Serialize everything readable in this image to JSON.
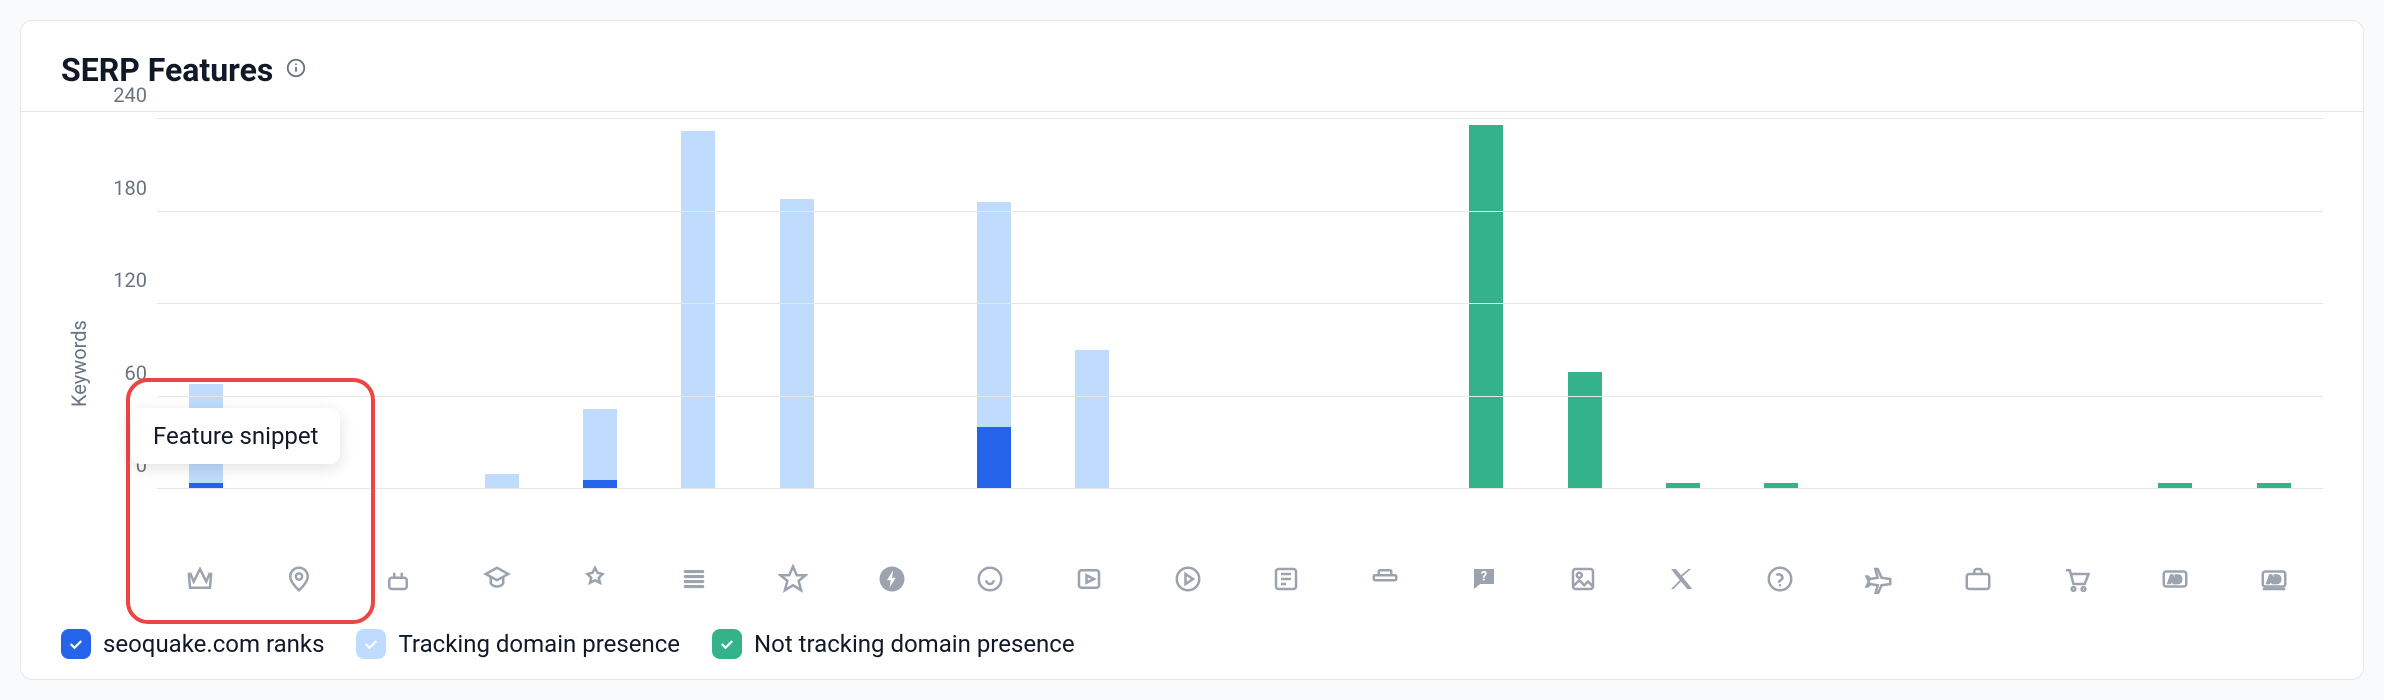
{
  "header": {
    "title": "SERP Features"
  },
  "axis": {
    "ylabel": "Keywords",
    "ymax": 240,
    "ticks": [
      0,
      60,
      120,
      180,
      240
    ]
  },
  "legend": {
    "ranks": "seoquake.com ranks",
    "tracking": "Tracking domain presence",
    "not_tracking": "Not tracking domain presence"
  },
  "tooltip": {
    "label": "Feature snippet"
  },
  "highlight_index": 0,
  "chart_data": {
    "type": "bar",
    "stacked": true,
    "ylabel": "Keywords",
    "ylim": [
      0,
      240
    ],
    "categories": [
      "featured-snippet",
      "local-pack",
      "ai-overview",
      "reviews",
      "knowledge-panel",
      "sitelinks",
      "top-stories",
      "amp",
      "carousel",
      "video",
      "video-carousel",
      "news",
      "recipe",
      "instant-answer",
      "image-pack",
      "twitter",
      "faq",
      "flights",
      "jobs",
      "shopping",
      "ads-top",
      "ads-bottom"
    ],
    "series": [
      {
        "name": "seoquake.com ranks",
        "color": "#2563eb",
        "values": [
          4,
          0,
          0,
          0,
          6,
          0,
          0,
          0,
          40,
          0,
          0,
          0,
          0,
          0,
          0,
          0,
          0,
          0,
          0,
          0,
          0,
          0
        ]
      },
      {
        "name": "Tracking domain presence",
        "color": "#bfdbfe",
        "values": [
          64,
          0,
          0,
          10,
          46,
          232,
          188,
          0,
          146,
          90,
          0,
          0,
          0,
          0,
          0,
          0,
          0,
          0,
          0,
          0,
          0,
          0
        ]
      },
      {
        "name": "Not tracking domain presence",
        "color": "#34b38a",
        "values": [
          0,
          0,
          0,
          0,
          0,
          0,
          0,
          0,
          0,
          0,
          0,
          0,
          0,
          236,
          76,
          4,
          4,
          0,
          0,
          0,
          4,
          4
        ]
      }
    ]
  }
}
